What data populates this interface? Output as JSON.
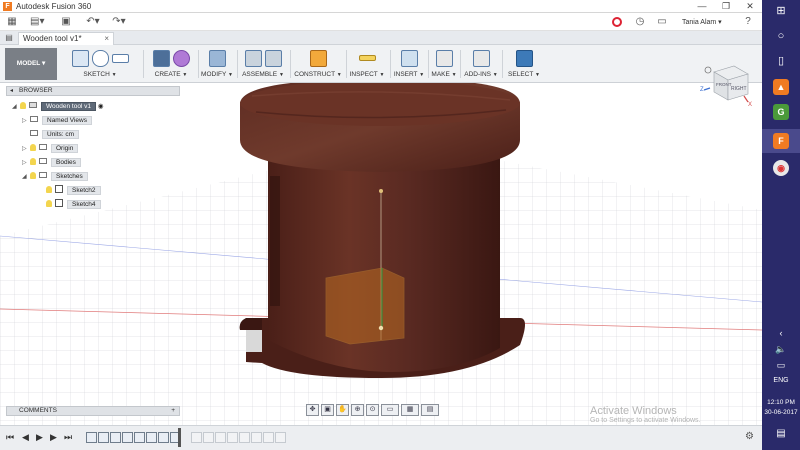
{
  "window": {
    "title": "Autodesk Fusion 360",
    "app_icon": "F",
    "buttons": [
      "—",
      "❐",
      "✕"
    ]
  },
  "quick_access": {
    "user": "Tania Alam ▾",
    "icons": [
      "grid-icon",
      "file-icon",
      "save-icon",
      "undo-icon",
      "redo-icon",
      "record-icon",
      "clock-icon",
      "help-icon"
    ]
  },
  "document_tab": {
    "title": "Wooden tool v1*",
    "close": "×"
  },
  "ribbon": {
    "workspace": "MODEL ▾",
    "groups": [
      {
        "id": "sketch",
        "label": "SKETCH"
      },
      {
        "id": "create",
        "label": "CREATE"
      },
      {
        "id": "modify",
        "label": "MODIFY"
      },
      {
        "id": "assemble",
        "label": "ASSEMBLE"
      },
      {
        "id": "construct",
        "label": "CONSTRUCT"
      },
      {
        "id": "inspect",
        "label": "INSPECT"
      },
      {
        "id": "insert",
        "label": "INSERT"
      },
      {
        "id": "make",
        "label": "MAKE"
      },
      {
        "id": "addins",
        "label": "ADD-INS"
      },
      {
        "id": "select",
        "label": "SELECT"
      }
    ]
  },
  "browser": {
    "header": "BROWSER",
    "root": "Wooden tool v1",
    "items": [
      {
        "label": "Named Views"
      },
      {
        "label": "Units: cm"
      },
      {
        "label": "Origin"
      },
      {
        "label": "Bodies"
      },
      {
        "label": "Sketches"
      },
      {
        "label": "Sketch2"
      },
      {
        "label": "Sketch4"
      }
    ]
  },
  "viewcube": {
    "face_front": "RIGHT",
    "face_side": "FRONT",
    "axis_z": "Z",
    "axis_x": "X"
  },
  "comments": {
    "label": "COMMENTS",
    "add": "+"
  },
  "timeline": {
    "controls": [
      "⏮",
      "◀",
      "▶",
      "▶",
      "⏭"
    ],
    "active_items": 8,
    "ghost_items": 8
  },
  "watermark": {
    "line1": "Activate Windows",
    "line2": "Go to Settings to activate Windows."
  },
  "taskbar": {
    "language": "ENG",
    "time": "12:10 PM",
    "date": "30-06-2017"
  },
  "colors": {
    "wood": "#5a2a22",
    "wood_dark": "#3e1a15",
    "accent": "#f07b22",
    "taskbar": "#2a2a6a"
  }
}
